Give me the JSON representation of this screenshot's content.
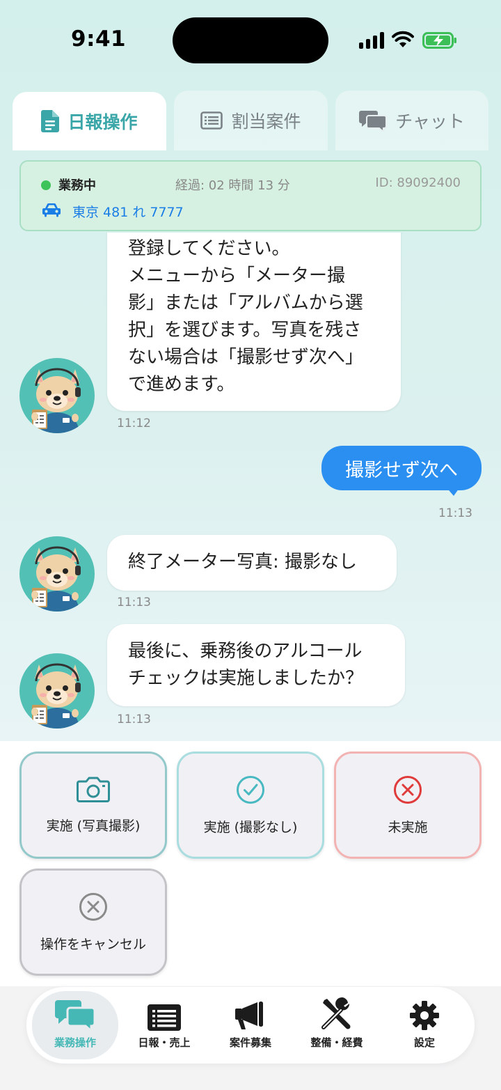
{
  "status_bar": {
    "time": "9:41"
  },
  "tabs": [
    {
      "label": "日報操作",
      "icon": "document-icon",
      "active": true
    },
    {
      "label": "割当案件",
      "icon": "list-icon",
      "active": false
    },
    {
      "label": "チャット",
      "icon": "chat-bubbles-icon",
      "active": false
    }
  ],
  "status_card": {
    "status": "業務中",
    "elapsed": "経過: 02 時間 13 分",
    "id": "ID: 89092400",
    "plate": "東京 481 れ 7777",
    "status_color": "#3dc35a"
  },
  "chat": {
    "messages": [
      {
        "from": "bot",
        "lines": [
          "登録してください。",
          "メニューから「メーター撮",
          "影」または「アルバムから選",
          "択」を選びます。写真を残さ",
          "ない場合は「撮影せず次へ」",
          "で進めます。"
        ],
        "time": "11:12"
      },
      {
        "from": "user",
        "text": "撮影せず次へ",
        "time": "11:13"
      },
      {
        "from": "bot",
        "lines": [
          "終了メーター写真: 撮影なし"
        ],
        "time": "11:13"
      },
      {
        "from": "bot",
        "lines": [
          "最後に、乗務後のアルコール",
          "チェックは実施しましたか？"
        ],
        "time": "11:13"
      }
    ]
  },
  "actions": [
    {
      "label": "実施 (写真撮影)",
      "icon": "camera-icon",
      "color": "#2e8f96"
    },
    {
      "label": "実施 (撮影なし)",
      "icon": "check-circle-icon",
      "color": "#48b9c1"
    },
    {
      "label": "未実施",
      "icon": "x-circle-icon",
      "color": "#e03b3b"
    },
    {
      "label": "操作をキャンセル",
      "icon": "cancel-circle-icon",
      "color": "#8a8a8a"
    }
  ],
  "bottom_nav": [
    {
      "label": "業務操作",
      "icon": "chat-bubbles-icon",
      "active": true
    },
    {
      "label": "日報・売上",
      "icon": "list-icon",
      "active": false
    },
    {
      "label": "案件募集",
      "icon": "megaphone-icon",
      "active": false
    },
    {
      "label": "整備・経費",
      "icon": "tools-icon",
      "active": false
    },
    {
      "label": "設定",
      "icon": "gear-icon",
      "active": false
    }
  ]
}
